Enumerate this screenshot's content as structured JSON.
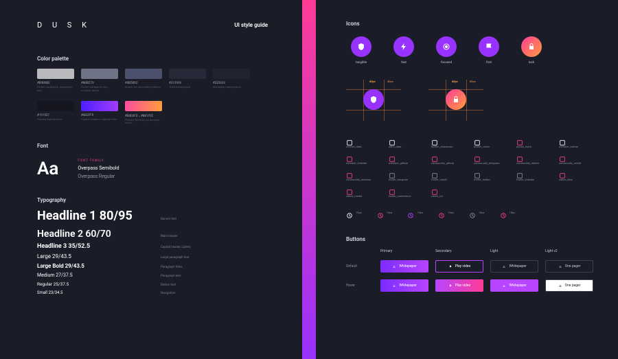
{
  "logo": "D U S K",
  "page_title": "UI style guide",
  "sections": {
    "palette": "Color palette",
    "font": "Font",
    "typography": "Typography",
    "icons": "Icons",
    "buttons": "Buttons"
  },
  "palette_row1": [
    {
      "hex": "#B9B9BE",
      "desc": "Footer navigation, paragraph text",
      "color": "#b9b9be"
    },
    {
      "hex": "#88BC79",
      "desc": "Footer navigation line, member name",
      "color": "#6f7386"
    },
    {
      "hex": "#4B506C",
      "desc": "Border for secondary buttons",
      "color": "#4b506c"
    },
    {
      "hex": "#312939",
      "desc": "Third background",
      "color": "#262a38"
    },
    {
      "hex": "#222933",
      "desc": "Secondary background",
      "color": "#1f2430"
    }
  ],
  "palette_row2": [
    {
      "hex": "#191927",
      "desc": "Primary background",
      "color": "#15161f"
    },
    {
      "hex": "#6B3FF9",
      "desc": "Capital headers, highlight line",
      "color": "#6b3ff9",
      "grad": "linear-gradient(90deg,#4b1fff,#a23dff)"
    },
    {
      "hex": "#B403FD→#881FEE",
      "desc": "Primary buttons, community icons",
      "color": "#ff6f55",
      "grad": "linear-gradient(90deg,#ff4da0,#ff9d3c)"
    }
  ],
  "font_family_label": "FONT FAMILY",
  "font_sample": "Aa",
  "font_semibold": "Overpass Semibold",
  "font_regular": "Overpass Regular",
  "typography": [
    {
      "sample": "Headline 1 80/95",
      "cls": "h1",
      "label": "Banner text"
    },
    {
      "sample": "Headline 2 60/70",
      "cls": "h2",
      "label": "Main header"
    },
    {
      "sample": "Headline 3 35/52.5",
      "cls": "h3",
      "label": "Capital header, Labels"
    },
    {
      "sample": "Large 29/43.5",
      "cls": "lg",
      "label": "Large paragraph text"
    },
    {
      "sample": "Large Bold 29/43.5",
      "cls": "lgb",
      "label": "Paragraph titles"
    },
    {
      "sample": "Medium 27/37.5",
      "cls": "md",
      "label": "Paragraph text"
    },
    {
      "sample": "Regular 25/37.5",
      "cls": "rg",
      "label": "Button text"
    },
    {
      "sample": "Small 23/34.5",
      "cls": "sm",
      "label": "Navigation"
    }
  ],
  "icons_big": [
    {
      "name": "tangible",
      "variant": "purple"
    },
    {
      "name": "fast",
      "variant": "purple"
    },
    {
      "name": "focused",
      "variant": "purple"
    },
    {
      "name": "first",
      "variant": "purple"
    },
    {
      "name": "lock",
      "variant": "grad"
    }
  ],
  "icon_spec_dims": [
    "60px",
    "40px",
    "20px",
    "30px",
    "60px",
    "40px"
  ],
  "icon_grid": [
    {
      "name": "receive_data",
      "c": "#fff"
    },
    {
      "name": "send_data",
      "c": "#fff"
    },
    {
      "name": "button_download",
      "c": "#fff"
    },
    {
      "name": "button_video",
      "c": "#fff"
    },
    {
      "name": "punch_mark",
      "c": "#ff3c96"
    },
    {
      "name": "member_button",
      "c": "#fff"
    },
    {
      "name": "member_linkedin",
      "c": "#ff3c96"
    },
    {
      "name": "member_github",
      "c": "#ff3c96"
    },
    {
      "name": "community_github",
      "c": "#ff3c96"
    },
    {
      "name": "community_telegram",
      "c": "#ff3c96"
    },
    {
      "name": "community_twitter",
      "c": "#ff3c96"
    },
    {
      "name": "community_reddit",
      "c": "#ff3c96"
    },
    {
      "name": "community_medium",
      "c": "#ff3c96"
    },
    {
      "name": "footer_telegram",
      "c": "#8a8fa3"
    },
    {
      "name": "footer_reddit",
      "c": "#8a8fa3"
    },
    {
      "name": "footer_twitter",
      "c": "#8a8fa3"
    },
    {
      "name": "footer_linkedin",
      "c": "#8a8fa3"
    },
    {
      "name": "cases_files",
      "c": "#ff3c96"
    },
    {
      "name": "cases_media",
      "c": "#ff3c96"
    },
    {
      "name": "footer_conference",
      "c": "#ff3c96"
    },
    {
      "name": "cases_iot",
      "c": "#ff3c96"
    }
  ],
  "icon_states": [
    "10px",
    "10px",
    "10px",
    "10px",
    "10px",
    "10px"
  ],
  "button_cols": [
    "Primary",
    "Secondary",
    "Light",
    "Light v2"
  ],
  "button_rows": [
    "Default",
    "Hover"
  ],
  "button_labels": {
    "whitepaper": "Whitepaper",
    "play_video": "Play video",
    "one_pager": "One pager"
  }
}
